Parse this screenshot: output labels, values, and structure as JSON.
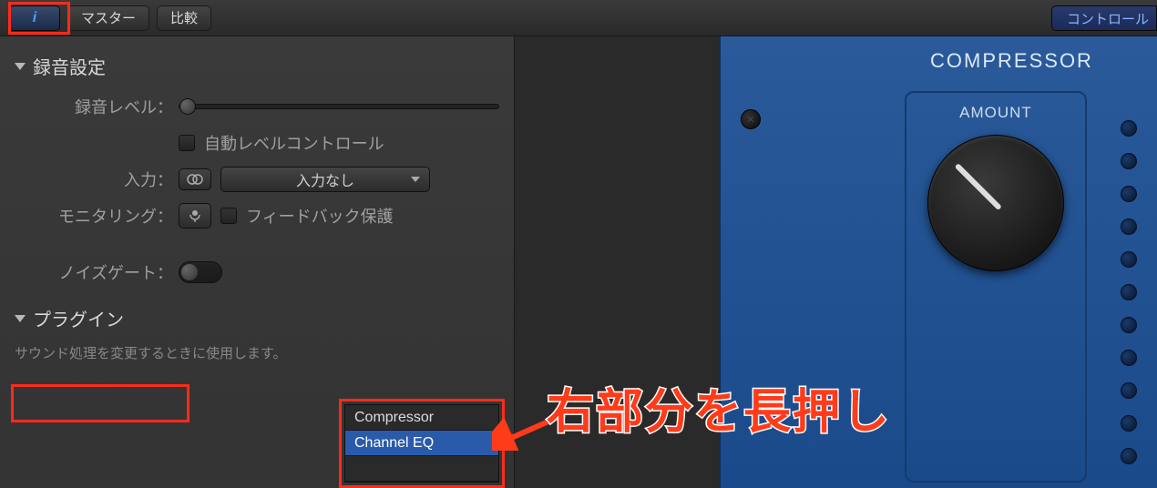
{
  "toolbar": {
    "info_icon": "i",
    "master_tab": "マスター",
    "compare_tab": "比較",
    "control_link": "コントロール"
  },
  "left": {
    "recording_header": "録音設定",
    "level_label": "録音レベル：",
    "auto_level_label": "自動レベルコントロール",
    "input_label": "入力：",
    "input_value": "入力なし",
    "monitoring_label": "モニタリング：",
    "feedback_label": "フィードバック保護",
    "noise_gate_label": "ノイズゲート：",
    "plugin_header": "プラグイン",
    "plugin_desc": "サウンド処理を変更するときに使用します。",
    "plugins": [
      "Compressor",
      "Channel EQ"
    ]
  },
  "compressor": {
    "title": "COMPRESSOR",
    "amount_label": "AMOUNT"
  },
  "annotation": "右部分を長押し"
}
